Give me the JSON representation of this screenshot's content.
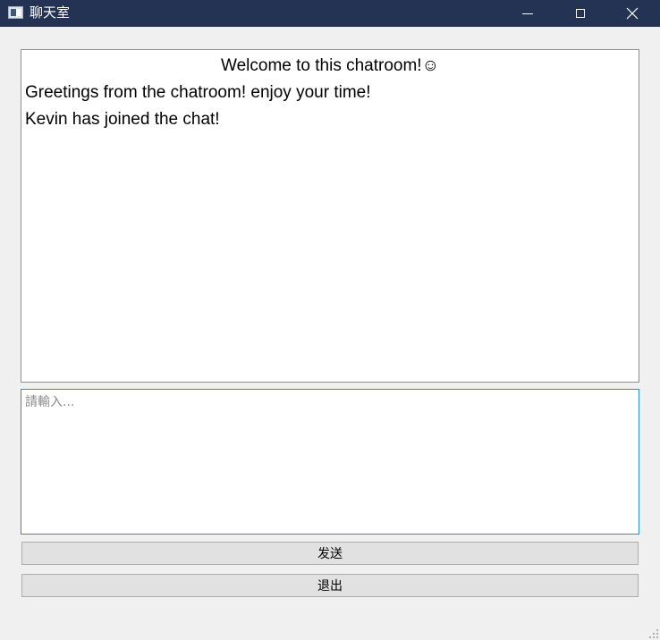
{
  "window": {
    "title": "聊天室",
    "icon": "app-window-icon",
    "controls": {
      "minimize": "minimize-icon",
      "maximize": "maximize-icon",
      "close": "✕"
    }
  },
  "chat": {
    "welcome": "Welcome to this chatroom!☺",
    "messages": [
      "Greetings from the chatroom! enjoy your time!",
      "Kevin has joined the chat!"
    ]
  },
  "input": {
    "value": "",
    "placeholder": "請輸入..."
  },
  "buttons": {
    "send_label": "发送",
    "quit_label": "退出"
  },
  "colors": {
    "titlebar": "#243353",
    "input_border_focus": "#2a8fc4",
    "button_bg": "#e1e1e1"
  }
}
